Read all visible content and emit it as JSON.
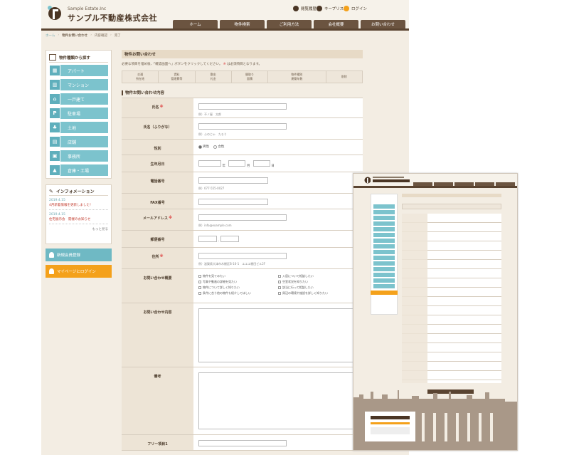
{
  "header": {
    "logo_en": "Sample Estate.Inc",
    "logo_jp": "サンプル不動産株式会社",
    "utility": [
      {
        "label": "閲覧履歴",
        "icon": "history-icon"
      },
      {
        "label": "キープリスト",
        "icon": "star-icon"
      },
      {
        "label": "ログイン",
        "icon": "login-icon"
      }
    ],
    "nav": [
      "ホーム",
      "物件検索",
      "ご利用方法",
      "会社概要",
      "お問い合わせ"
    ]
  },
  "breadcrumb": [
    "ホーム",
    "物件お問い合わせ",
    "内容確認",
    "完了"
  ],
  "sidebar": {
    "title": "物件種類から探す",
    "types": [
      {
        "label": "アパート",
        "icon": "apartment-icon"
      },
      {
        "label": "マンション",
        "icon": "mansion-icon"
      },
      {
        "label": "一戸建て",
        "icon": "house-icon"
      },
      {
        "label": "駐車場",
        "icon": "parking-icon"
      },
      {
        "label": "土地",
        "icon": "land-icon"
      },
      {
        "label": "店舗",
        "icon": "store-icon"
      },
      {
        "label": "事務所",
        "icon": "office-icon"
      },
      {
        "label": "倉庫・工場",
        "icon": "factory-icon"
      }
    ],
    "info": {
      "title": "インフォメーション",
      "items": [
        {
          "date": "2019.4.15",
          "text": "4月新着情報を更新しました！"
        },
        {
          "date": "2019.4.15",
          "text": "住宅展示会　開催のお知らせ"
        }
      ],
      "more": "もっと見る"
    },
    "member_button": "新規会員登録",
    "mypage_button": "マイページにログイン"
  },
  "main": {
    "section_title": "物件お問い合わせ",
    "notice": "必要な項目を埋め後、「確認画面へ」ボタンをクリックしてください。",
    "notice_req": "※",
    "notice_tail": "は必須項目となります。",
    "steps": [
      [
        "交通",
        "所在地"
      ],
      [
        "賃料",
        "管理費等"
      ],
      [
        "敷金",
        "礼金"
      ],
      [
        "間取り",
        "面積"
      ],
      [
        "物件種別",
        "建築年数"
      ],
      [
        "削除",
        ""
      ]
    ],
    "form_title": "物件お問い合わせ内容",
    "req_mark": "※",
    "fields": {
      "name": {
        "label": "氏名",
        "example": "例）不ノ屋　太郎"
      },
      "kana": {
        "label": "氏名（ふりがな）",
        "example": "例）ふのじゃ　たろう"
      },
      "gender": {
        "label": "性別",
        "options": [
          "男性",
          "女性"
        ]
      },
      "birth": {
        "label": "生年月日",
        "year": "年",
        "month": "月",
        "day": "日"
      },
      "tel": {
        "label": "電話番号",
        "example": "例）077-555-0027"
      },
      "fax": {
        "label": "FAX番号"
      },
      "email": {
        "label": "メールアドレス",
        "example": "例）info@example.com"
      },
      "zip": {
        "label": "郵便番号",
        "dash": "-"
      },
      "address": {
        "label": "住所",
        "example": "例）滋賀県大津市木棚区B-16-1　エエエ棚田ビル2F"
      },
      "inquiry_type": {
        "label": "お問い合わせ概要",
        "options": [
          "物件を見てみたい",
          "入居について相談したい",
          "写真や動画の詳細を見たい",
          "空室状況を知りたい",
          "物件について詳しく知りたい",
          "該当に行って相談したい",
          "条件に合う他の物件も紹介してほしい",
          "周辺の環境や施設を詳しく知りたい"
        ]
      },
      "inquiry_body": {
        "label": "お問い合わせ内容"
      },
      "remarks": {
        "label": "備考"
      },
      "free1": {
        "label": "フリー項目1"
      }
    }
  },
  "colors": {
    "accent": "#7cc3cd",
    "brand": "#5a4431",
    "orange": "#f4a11b",
    "page_bg": "#f3ede3"
  }
}
